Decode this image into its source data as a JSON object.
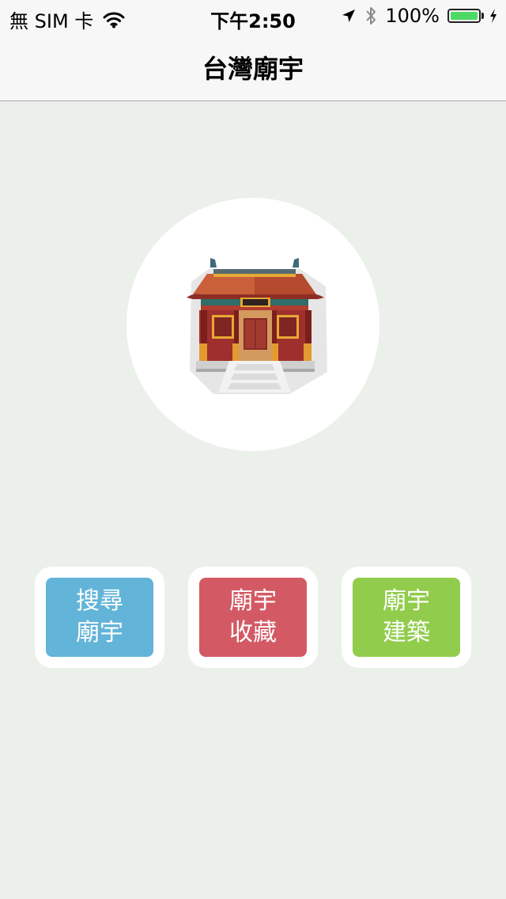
{
  "status_bar": {
    "carrier": "無 SIM 卡",
    "time": "下午2:50",
    "battery": "100%",
    "battery_level": 1.0,
    "battery_color": "#4cd964",
    "icons": [
      "wifi-icon",
      "location-arrow-icon",
      "bluetooth-icon",
      "battery-icon",
      "charging-bolt-icon"
    ]
  },
  "nav": {
    "title": "台灣廟宇"
  },
  "hero": {
    "icon": "temple-icon"
  },
  "menu": {
    "buttons": [
      {
        "line1": "搜尋",
        "line2": "廟宇",
        "color": "#62b4d8"
      },
      {
        "line1": "廟宇",
        "line2": "收藏",
        "color": "#d35a64"
      },
      {
        "line1": "廟宇",
        "line2": "建築",
        "color": "#91cc4c"
      }
    ]
  },
  "colors": {
    "background": "#ecf0ea",
    "bar": "#f7f7f7"
  }
}
